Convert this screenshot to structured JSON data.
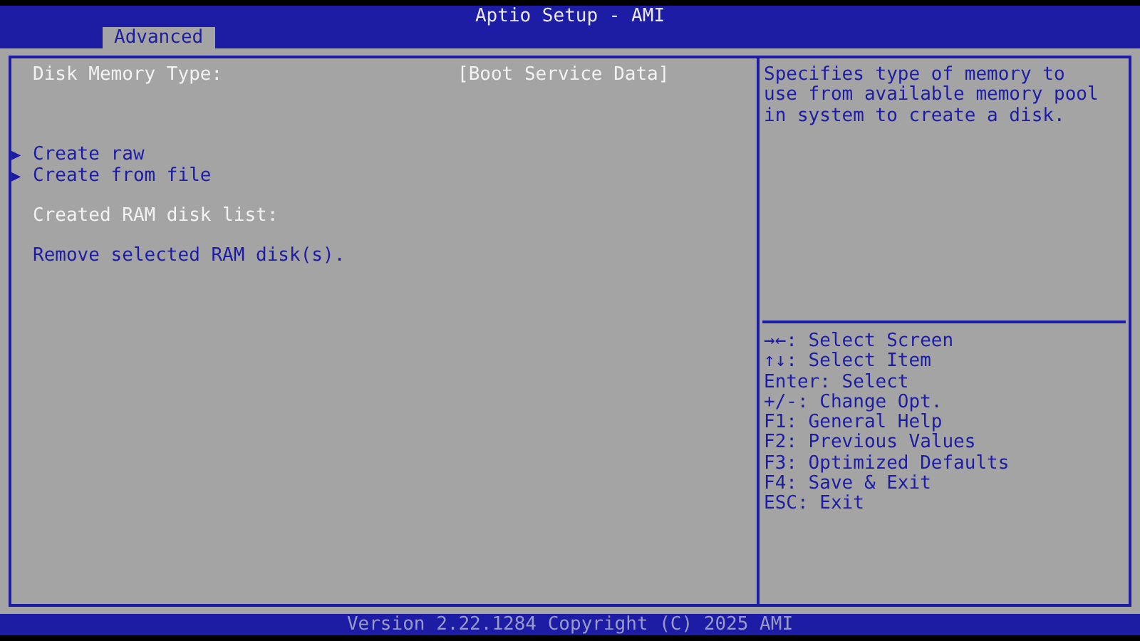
{
  "window": {
    "title": "Aptio Setup - AMI"
  },
  "tabs": [
    {
      "label": "Advanced",
      "selected": true
    }
  ],
  "groups": [
    [
      {
        "kind": "setting",
        "label": "Disk Memory Type:",
        "value": "[Boot Service Data]"
      }
    ],
    [
      {
        "kind": "submenu",
        "label": "Create raw",
        "arrow": "▶"
      },
      {
        "kind": "submenu",
        "label": "Create from file",
        "arrow": "▶"
      }
    ],
    [
      {
        "kind": "label",
        "label": "Created RAM disk list:"
      }
    ],
    [
      {
        "kind": "action",
        "label": "Remove selected RAM disk(s)."
      }
    ]
  ],
  "help_text": [
    "Specifies type of memory to",
    "use from available memory pool",
    "in system to create a disk."
  ],
  "key_legend": [
    "→←: Select Screen",
    "↑↓: Select Item",
    "Enter: Select",
    "+/-: Change Opt.",
    "F1: General Help",
    "F2: Previous Values",
    "F3: Optimized Defaults",
    "F4: Save & Exit",
    "ESC: Exit"
  ],
  "status_bar": "Version 2.22.1284 Copyright (C) 2025 AMI"
}
